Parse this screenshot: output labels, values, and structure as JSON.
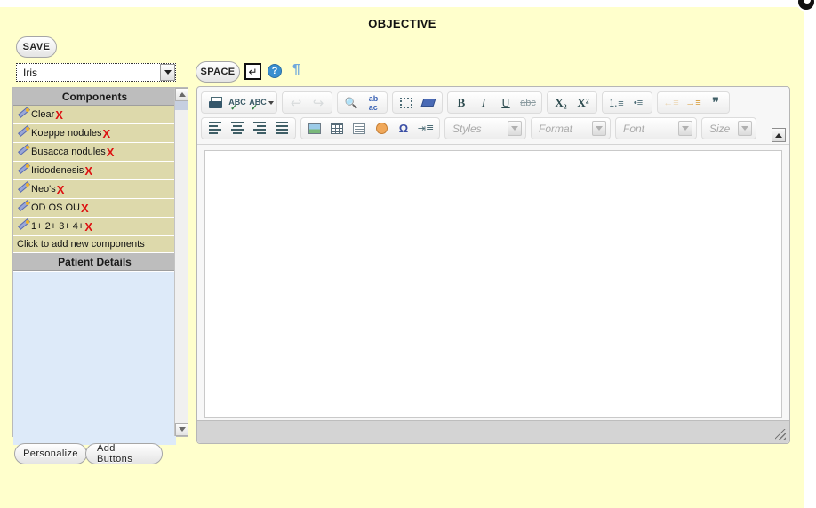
{
  "page": {
    "title": "OBJECTIVE",
    "background_color": "#ffffcc"
  },
  "toolbar_top": {
    "save_label": "SAVE",
    "space_label": "SPACE",
    "enter_key_glyph": "↵",
    "help_glyph": "?",
    "pilcrow_glyph": "¶"
  },
  "component_select": {
    "value": "Iris",
    "options": [
      "Iris"
    ]
  },
  "left_panel": {
    "components_header": "Components",
    "components": [
      {
        "label": "Clear"
      },
      {
        "label": "Koeppe nodules"
      },
      {
        "label": "Busacca nodules"
      },
      {
        "label": "Iridodenesis"
      },
      {
        "label": "Neo's"
      },
      {
        "label": "OD OS OU"
      },
      {
        "label": "1+ 2+ 3+ 4+"
      }
    ],
    "delete_glyph": "X",
    "add_new_label": "Click to add new components",
    "patient_details_header": "Patient Details",
    "patient_details_body": ""
  },
  "footer_buttons": {
    "personalize_label": "Personalize",
    "add_buttons_label": "Add Buttons"
  },
  "editor": {
    "content": "",
    "toolbar_row1": [
      {
        "name": "print",
        "title": "Print"
      },
      {
        "name": "spellcheck",
        "title": "Check Spelling"
      },
      {
        "name": "spellcheck-menu",
        "title": "Spell Check As You Type"
      },
      {
        "name": "undo",
        "title": "Undo"
      },
      {
        "name": "redo",
        "title": "Redo"
      },
      {
        "name": "find",
        "title": "Find"
      },
      {
        "name": "replace",
        "title": "Replace"
      },
      {
        "name": "select-all",
        "title": "Select All"
      },
      {
        "name": "remove-format",
        "title": "Remove Format"
      },
      {
        "name": "bold",
        "title": "Bold",
        "glyph": "B"
      },
      {
        "name": "italic",
        "title": "Italic",
        "glyph": "I"
      },
      {
        "name": "underline",
        "title": "Underline",
        "glyph": "U"
      },
      {
        "name": "strike",
        "title": "Strike Through",
        "glyph": "abc"
      },
      {
        "name": "subscript",
        "title": "Subscript",
        "glyph": "X₂"
      },
      {
        "name": "superscript",
        "title": "Superscript",
        "glyph": "X²"
      },
      {
        "name": "numbered-list",
        "title": "Insert/Remove Numbered List"
      },
      {
        "name": "bulleted-list",
        "title": "Insert/Remove Bulleted List"
      },
      {
        "name": "outdent",
        "title": "Decrease Indent"
      },
      {
        "name": "indent",
        "title": "Increase Indent"
      },
      {
        "name": "blockquote",
        "title": "Block Quote",
        "glyph": "❞"
      }
    ],
    "toolbar_row2": [
      {
        "name": "align-left",
        "title": "Align Left"
      },
      {
        "name": "align-center",
        "title": "Center"
      },
      {
        "name": "align-right",
        "title": "Align Right"
      },
      {
        "name": "justify",
        "title": "Justify"
      },
      {
        "name": "image",
        "title": "Image"
      },
      {
        "name": "table",
        "title": "Table"
      },
      {
        "name": "horizontal-rule",
        "title": "Horizontal Line"
      },
      {
        "name": "smiley",
        "title": "Smiley"
      },
      {
        "name": "special-char",
        "title": "Insert Special Character",
        "glyph": "Ω"
      },
      {
        "name": "page-break",
        "title": "Page Break"
      }
    ],
    "selects": {
      "styles": "Styles",
      "format": "Format",
      "font": "Font",
      "size": "Size"
    }
  }
}
